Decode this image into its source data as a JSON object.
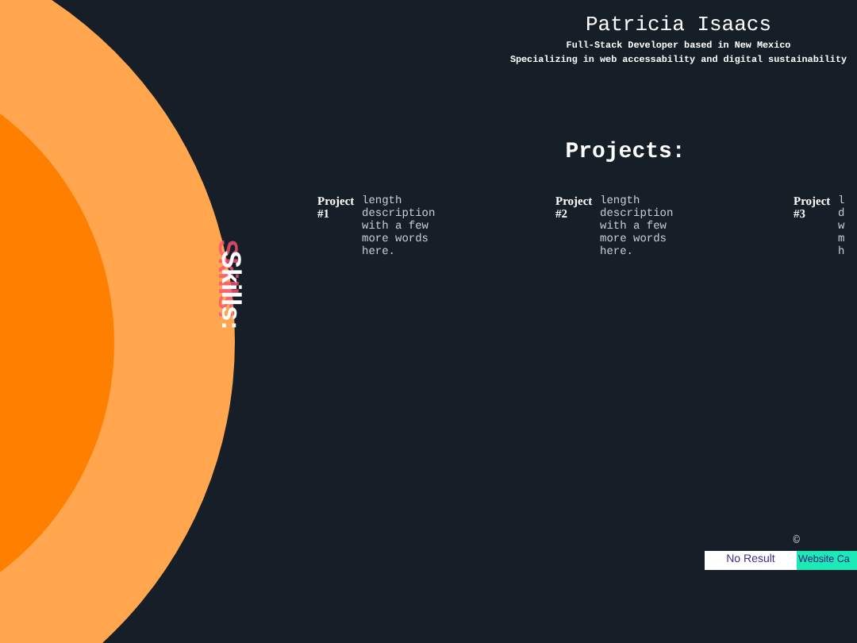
{
  "header": {
    "name": "Patricia Isaacs",
    "tagline": "Full-Stack Developer based in New Mexico",
    "specialty": "Specializing in web accessability and digital sustainability"
  },
  "skills": {
    "label": "Skills:"
  },
  "projects": {
    "heading": "Projects:",
    "items": [
      {
        "title": "Project #1",
        "description": "length description with a few more words here."
      },
      {
        "title": "Project #2",
        "description": "length description with a few more words here."
      },
      {
        "title": "Project #3",
        "description": "l d w m h"
      }
    ]
  },
  "footer": {
    "copyright": "©",
    "buttons": [
      {
        "label": "No Result",
        "kind": "plain"
      },
      {
        "label": "Website Ca",
        "kind": "accent"
      }
    ]
  }
}
